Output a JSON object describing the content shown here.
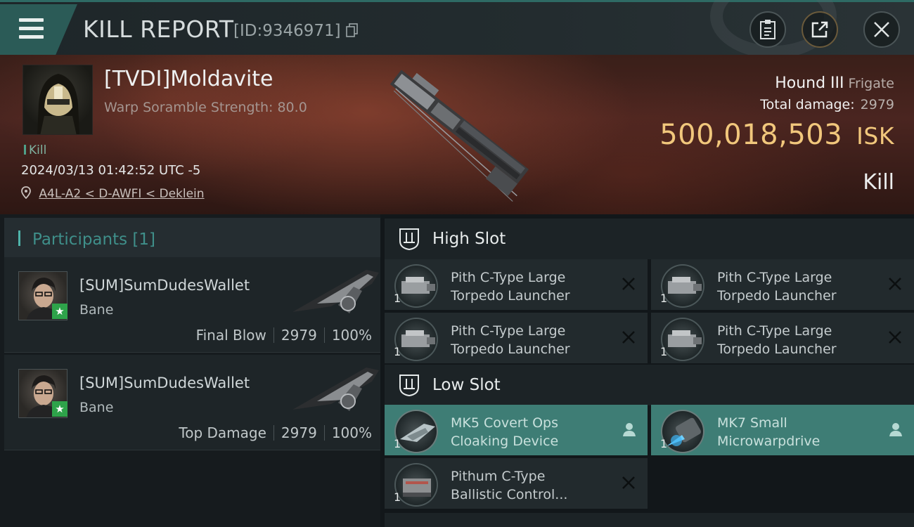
{
  "topbar": {
    "title": "KILL REPORT",
    "report_id": "[ID:9346971]",
    "icons": [
      "menu-icon",
      "copy-icon",
      "clipboard-icon",
      "share-icon",
      "close-icon"
    ]
  },
  "victim": {
    "name": "[TVDI]Moldavite",
    "warp_scramble": "Warp Soramble Strength: 80.0",
    "kill_tag": "Kill",
    "timestamp": "2024/03/13 01:42:52 UTC -5",
    "location": "A4L-A2 < D-AWFI < Deklein",
    "ship_name": "Hound III",
    "ship_class": "Frigate",
    "total_damage_label": "Total damage:",
    "total_damage": "2979",
    "isk_value": "500,018,503",
    "isk_unit": "ISK",
    "result": "Kill"
  },
  "participants": {
    "header": "Participants [1]",
    "items": [
      {
        "name": "[SUM]SumDudesWallet",
        "ship": "Bane",
        "role": "Final Blow",
        "damage": "2979",
        "percent": "100%"
      },
      {
        "name": "[SUM]SumDudesWallet",
        "ship": "Bane",
        "role": "Top Damage",
        "damage": "2979",
        "percent": "100%"
      }
    ]
  },
  "fitting": {
    "high_slot": {
      "label": "High Slot",
      "modules": [
        {
          "line1": "Pith C-Type Large",
          "line2": "Torpedo Launcher",
          "qty": "1"
        },
        {
          "line1": "Pith C-Type Large",
          "line2": "Torpedo Launcher",
          "qty": "1"
        },
        {
          "line1": "Pith C-Type Large",
          "line2": "Torpedo Launcher",
          "qty": "1"
        },
        {
          "line1": "Pith C-Type Large",
          "line2": "Torpedo Launcher",
          "qty": "1"
        }
      ]
    },
    "low_slot": {
      "label": "Low Slot",
      "modules": [
        {
          "line1": "MK5 Covert Ops",
          "line2": "Cloaking Device",
          "qty": "1",
          "status": "fitted"
        },
        {
          "line1": "MK7 Small",
          "line2": "Microwarpdrive",
          "qty": "1",
          "status": "fitted"
        },
        {
          "line1": "Pithum C-Type",
          "line2": "Ballistic Control...",
          "qty": "1",
          "status": "destroyed"
        }
      ]
    }
  },
  "colors": {
    "accent": "#3e7d75",
    "isk_gold": "#f1c77c",
    "kill_green": "#4fa088",
    "header_red": "#4a2520"
  }
}
